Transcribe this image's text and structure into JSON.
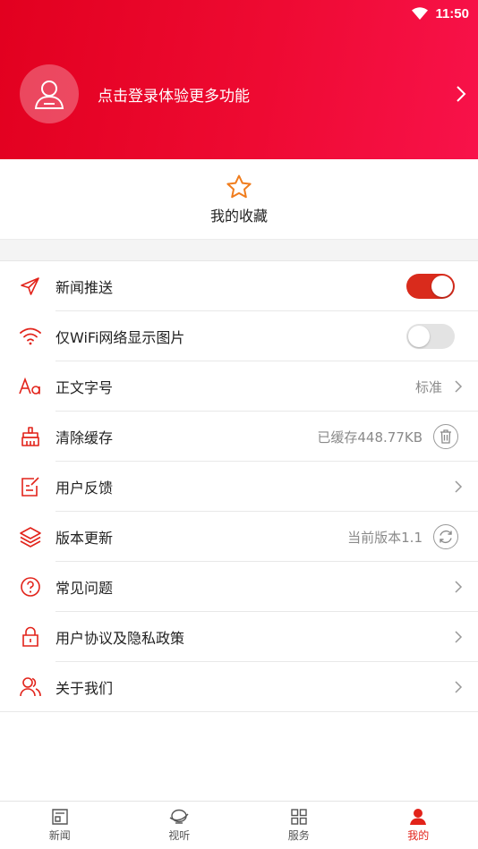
{
  "status_bar": {
    "time": "11:50"
  },
  "header": {
    "login_prompt": "点击登录体验更多功能"
  },
  "favorites": {
    "label": "我的收藏"
  },
  "settings": {
    "push": {
      "label": "新闻推送",
      "enabled": true
    },
    "wifi_images": {
      "label": "仅WiFi网络显示图片",
      "enabled": false
    },
    "font_size": {
      "label": "正文字号",
      "value": "标准"
    },
    "clear_cache": {
      "label": "清除缓存",
      "value": "已缓存448.77KB"
    },
    "feedback": {
      "label": "用户反馈"
    },
    "update": {
      "label": "版本更新",
      "value": "当前版本1.1"
    },
    "faq": {
      "label": "常见问题"
    },
    "privacy": {
      "label": "用户协议及隐私政策"
    },
    "about": {
      "label": "关于我们"
    }
  },
  "tabs": [
    {
      "label": "新闻",
      "icon": "news-icon",
      "active": false
    },
    {
      "label": "视听",
      "icon": "media-icon",
      "active": false
    },
    {
      "label": "服务",
      "icon": "grid-icon",
      "active": false
    },
    {
      "label": "我的",
      "icon": "user-icon",
      "active": true
    }
  ],
  "colors": {
    "accent": "#e2231a",
    "header_start": "#e2001f",
    "header_end": "#f8124a",
    "favorite_star": "#f07d1e"
  }
}
